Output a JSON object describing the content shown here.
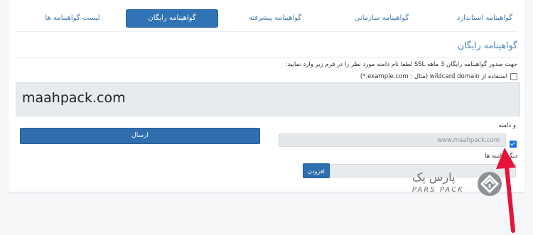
{
  "tabs": [
    {
      "label": "گواهینامه استاندارد"
    },
    {
      "label": "گواهینامه سازمانی"
    },
    {
      "label": "گواهینامه پیشرفته"
    },
    {
      "label": "گواهینامه رایگان",
      "active": true
    },
    {
      "label": "لیست گواهینامه ها"
    }
  ],
  "page": {
    "heading": "گواهینامه رایگان",
    "description": "جهت صدور گواهینامه رایگان 3 ماهه SSL لطفا نام دامنه مورد نظر را در فرم زیر وارد نمایید:",
    "wildcard_label": "استفاده از wildcard domain (مثال : example.com.*)",
    "domain_value": "maahpack.com",
    "va_label": "و دامنه",
    "www_domain": "www.maahpack.com",
    "other_domains_label": "دیگر دامنه ها",
    "send_button": "ارسال",
    "add_button": "افزودن"
  },
  "logo": {
    "text_fa": "پارس پک",
    "text_en": "PARS PACK"
  },
  "colors": {
    "accent": "#3174b6",
    "heading": "#4c84b8",
    "arrow": "#e5123a"
  }
}
